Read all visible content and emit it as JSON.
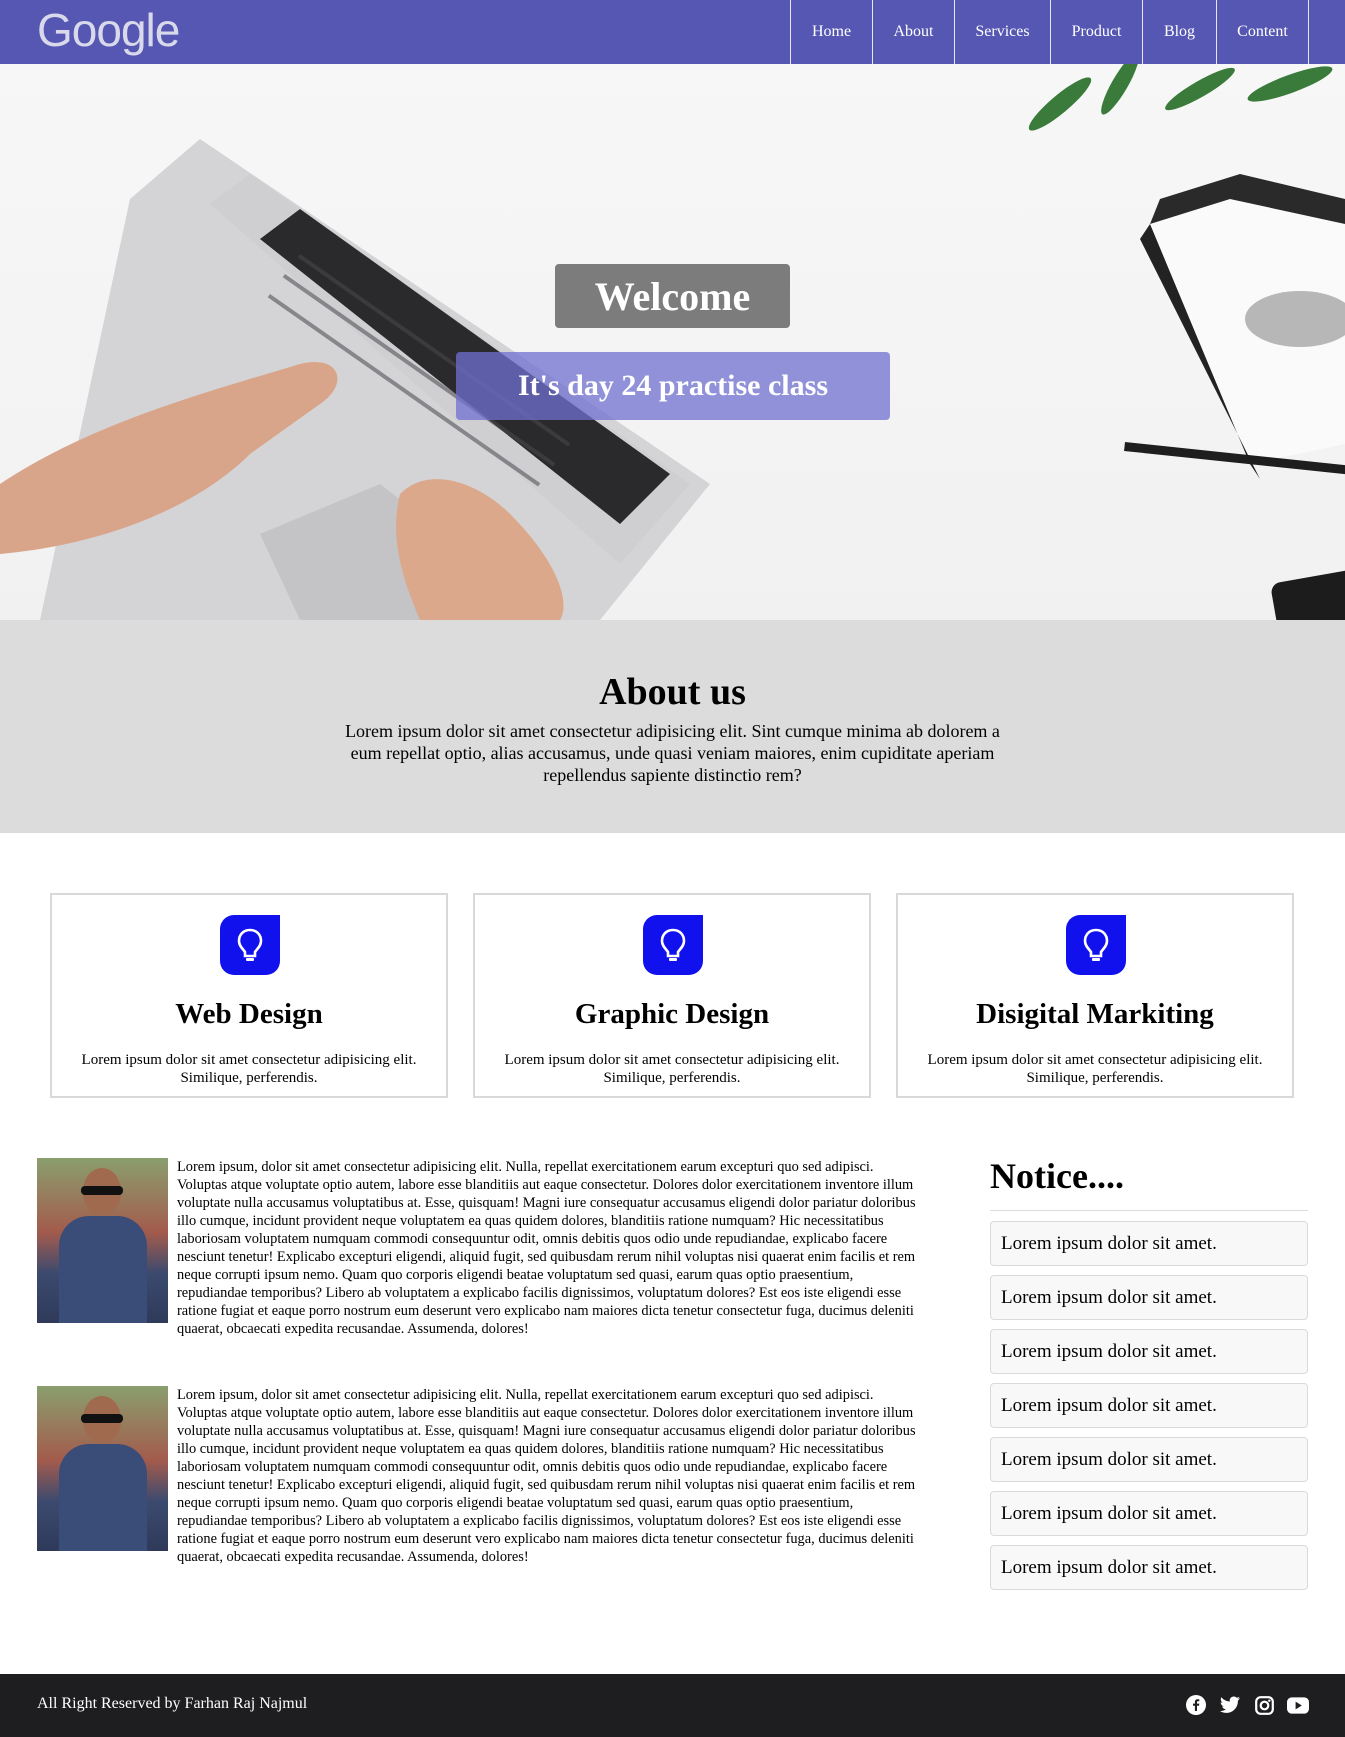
{
  "header": {
    "logo": "Google",
    "nav": [
      "Home",
      "About",
      "Services",
      "Product",
      "Blog",
      "Content"
    ]
  },
  "hero": {
    "title": "Welcome",
    "subtitle": "It's day 24 practise class"
  },
  "about": {
    "title": "About us",
    "text": "Lorem ipsum dolor sit amet consectetur adipisicing elit. Sint cumque minima ab dolorem a eum repellat optio, alias accusamus, unde quasi veniam maiores, enim cupiditate aperiam repellendus sapiente distinctio rem?"
  },
  "services": [
    {
      "icon": "lightbulb-icon",
      "title": "Web Design",
      "text": "Lorem ipsum dolor sit amet consectetur adipisicing elit. Similique, perferendis."
    },
    {
      "icon": "lightbulb-icon",
      "title": "Graphic Design",
      "text": "Lorem ipsum dolor sit amet consectetur adipisicing elit. Similique, perferendis."
    },
    {
      "icon": "lightbulb-icon",
      "title": "Disigital Markiting",
      "text": "Lorem ipsum dolor sit amet consectetur adipisicing elit. Similique, perferendis."
    }
  ],
  "articles": [
    {
      "text": "Lorem ipsum, dolor sit amet consectetur adipisicing elit. Nulla, repellat exercitationem earum excepturi quo sed adipisci. Voluptas atque voluptate optio autem, labore esse blanditiis aut eaque consectetur. Dolores dolor exercitationem inventore illum voluptate nulla accusamus voluptatibus at. Esse, quisquam! Magni iure consequatur accusamus eligendi dolor pariatur doloribus illo cumque, incidunt provident neque voluptatem ea quas quidem dolores, blanditiis ratione numquam? Hic necessitatibus laboriosam voluptatem numquam commodi consequuntur odit, omnis debitis quos odio unde repudiandae, explicabo facere nesciunt tenetur! Explicabo excepturi eligendi, aliquid fugit, sed quibusdam rerum nihil voluptas nisi quaerat enim facilis et rem neque corrupti ipsum nemo. Quam quo corporis eligendi beatae voluptatum sed quasi, earum quas optio praesentium, repudiandae temporibus? Libero ab voluptatem a explicabo facilis dignissimos, voluptatum dolores? Est eos iste eligendi esse ratione fugiat et eaque porro nostrum eum deserunt vero explicabo nam maiores dicta tenetur consectetur fuga, ducimus deleniti quaerat, obcaecati expedita recusandae. Assumenda, dolores!"
    },
    {
      "text": "Lorem ipsum, dolor sit amet consectetur adipisicing elit. Nulla, repellat exercitationem earum excepturi quo sed adipisci. Voluptas atque voluptate optio autem, labore esse blanditiis aut eaque consectetur. Dolores dolor exercitationem inventore illum voluptate nulla accusamus voluptatibus at. Esse, quisquam! Magni iure consequatur accusamus eligendi dolor pariatur doloribus illo cumque, incidunt provident neque voluptatem ea quas quidem dolores, blanditiis ratione numquam? Hic necessitatibus laboriosam voluptatem numquam commodi consequuntur odit, omnis debitis quos odio unde repudiandae, explicabo facere nesciunt tenetur! Explicabo excepturi eligendi, aliquid fugit, sed quibusdam rerum nihil voluptas nisi quaerat enim facilis et rem neque corrupti ipsum nemo. Quam quo corporis eligendi beatae voluptatum sed quasi, earum quas optio praesentium, repudiandae temporibus? Libero ab voluptatem a explicabo facilis dignissimos, voluptatum dolores? Est eos iste eligendi esse ratione fugiat et eaque porro nostrum eum deserunt vero explicabo nam maiores dicta tenetur consectetur fuga, ducimus deleniti quaerat, obcaecati expedita recusandae. Assumenda, dolores!"
    }
  ],
  "notice": {
    "title": "Notice....",
    "items": [
      "Lorem ipsum dolor sit amet.",
      "Lorem ipsum dolor sit amet.",
      "Lorem ipsum dolor sit amet.",
      "Lorem ipsum dolor sit amet.",
      "Lorem ipsum dolor sit amet.",
      "Lorem ipsum dolor sit amet.",
      "Lorem ipsum dolor sit amet."
    ]
  },
  "footer": {
    "text": "All Right Reserved by Farhan Raj Najmul",
    "social": [
      "facebook-icon",
      "twitter-icon",
      "instagram-icon",
      "youtube-icon"
    ]
  },
  "colors": {
    "nav_bg": "#5557b3",
    "icon_bg": "#1111ee",
    "about_bg": "#dcdcdc",
    "footer_bg": "#1e1e20"
  }
}
